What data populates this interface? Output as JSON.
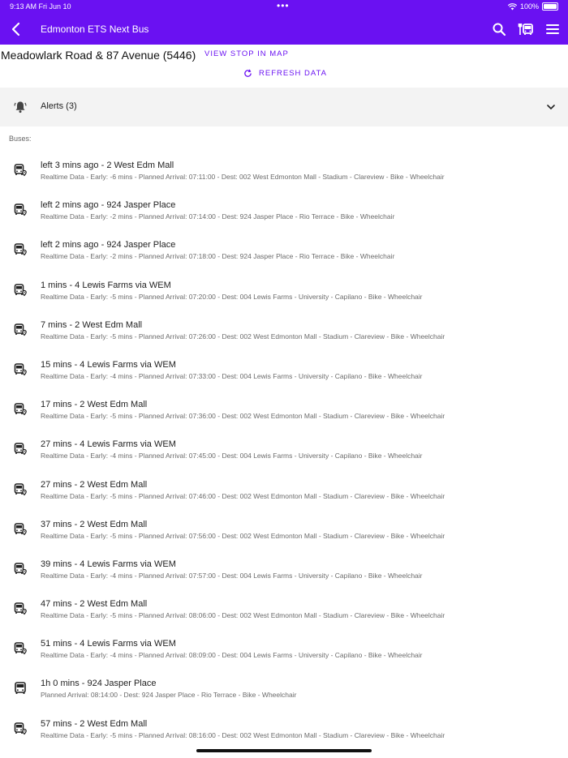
{
  "status_bar": {
    "time": "9:13 AM   Fri Jun 10",
    "dots": "•••",
    "battery": "100%"
  },
  "app_bar": {
    "title": "Edmonton ETS Next Bus"
  },
  "stop": {
    "title": "Meadowlark Road & 87 Avenue (5446)",
    "view_map_label": "VIEW STOP IN MAP",
    "refresh_label": "REFRESH DATA"
  },
  "alerts": {
    "label": "Alerts (3)"
  },
  "buses_label": "Buses:",
  "buses": [
    {
      "title": "left 3 mins ago - 2 West Edm Mall",
      "detail": "Realtime Data - Early: -6 mins - Planned Arrival: 07:11:00 - Dest: 002 West Edmonton Mall - Stadium - Clareview - Bike  - Wheelchair",
      "realtime": true
    },
    {
      "title": "left 2 mins ago -  924 Jasper Place",
      "detail": "Realtime Data - Early: -2 mins - Planned Arrival: 07:14:00 - Dest: 924 Jasper Place - Rio Terrace - Bike  - Wheelchair",
      "realtime": true
    },
    {
      "title": "left 2 mins ago -  924 Jasper Place",
      "detail": "Realtime Data - Early: -2 mins - Planned Arrival: 07:18:00 - Dest: 924 Jasper Place - Rio Terrace - Bike  - Wheelchair",
      "realtime": true
    },
    {
      "title": "1 mins -  4 Lewis Farms via WEM",
      "detail": "Realtime Data - Early: -5 mins - Planned Arrival: 07:20:00 - Dest: 004 Lewis Farms - University - Capilano - Bike  - Wheelchair",
      "realtime": true
    },
    {
      "title": "7 mins -  2 West Edm Mall",
      "detail": "Realtime Data - Early: -5 mins - Planned Arrival: 07:26:00 - Dest: 002 West Edmonton Mall - Stadium - Clareview - Bike  - Wheelchair",
      "realtime": true
    },
    {
      "title": "15 mins -  4 Lewis Farms via WEM",
      "detail": "Realtime Data - Early: -4 mins - Planned Arrival: 07:33:00 - Dest: 004 Lewis Farms - University - Capilano - Bike  - Wheelchair",
      "realtime": true
    },
    {
      "title": "17 mins -  2 West Edm Mall",
      "detail": "Realtime Data - Early: -5 mins - Planned Arrival: 07:36:00 - Dest: 002 West Edmonton Mall - Stadium - Clareview - Bike  - Wheelchair",
      "realtime": true
    },
    {
      "title": "27 mins -  4 Lewis Farms via WEM",
      "detail": "Realtime Data - Early: -4 mins - Planned Arrival: 07:45:00 - Dest: 004 Lewis Farms - University - Capilano - Bike  - Wheelchair",
      "realtime": true
    },
    {
      "title": "27 mins -  2 West Edm Mall",
      "detail": "Realtime Data - Early: -5 mins - Planned Arrival: 07:46:00 - Dest: 002 West Edmonton Mall - Stadium - Clareview - Bike  - Wheelchair",
      "realtime": true
    },
    {
      "title": "37 mins -  2 West Edm Mall",
      "detail": "Realtime Data - Early: -5 mins - Planned Arrival: 07:56:00 - Dest: 002 West Edmonton Mall - Stadium - Clareview - Bike  - Wheelchair",
      "realtime": true
    },
    {
      "title": "39 mins -  4 Lewis Farms via WEM",
      "detail": "Realtime Data - Early: -4 mins - Planned Arrival: 07:57:00 - Dest: 004 Lewis Farms - University - Capilano - Bike  - Wheelchair",
      "realtime": true
    },
    {
      "title": "47 mins -  2 West Edm Mall",
      "detail": "Realtime Data - Early: -5 mins - Planned Arrival: 08:06:00 - Dest: 002 West Edmonton Mall - Stadium - Clareview - Bike  - Wheelchair",
      "realtime": true
    },
    {
      "title": "51 mins -  4 Lewis Farms via WEM",
      "detail": "Realtime Data - Early: -4 mins - Planned Arrival: 08:09:00 - Dest: 004 Lewis Farms - University - Capilano - Bike  - Wheelchair",
      "realtime": true
    },
    {
      "title": "1h 0 mins - 924 Jasper Place",
      "detail": "Planned Arrival: 08:14:00 - Dest: 924 Jasper Place - Rio Terrace - Bike  - Wheelchair",
      "realtime": false
    },
    {
      "title": "57 mins -  2 West Edm Mall",
      "detail": "Realtime Data - Early: -5 mins - Planned Arrival: 08:16:00 - Dest: 002 West Edmonton Mall - Stadium - Clareview - Bike  - Wheelchair",
      "realtime": true
    }
  ],
  "icons": {
    "back": "chevron-left-icon",
    "search": "search-icon",
    "bus_route": "bus-route-icon",
    "menu": "menu-icon",
    "refresh": "refresh-icon",
    "alerts": "bell-icon",
    "expand": "chevron-down-icon",
    "realtime_bus": "bus-realtime-icon",
    "scheduled_bus": "bus-icon"
  },
  "colors": {
    "accent": "#6a11f2",
    "alert_bg": "#f3f3f3"
  }
}
